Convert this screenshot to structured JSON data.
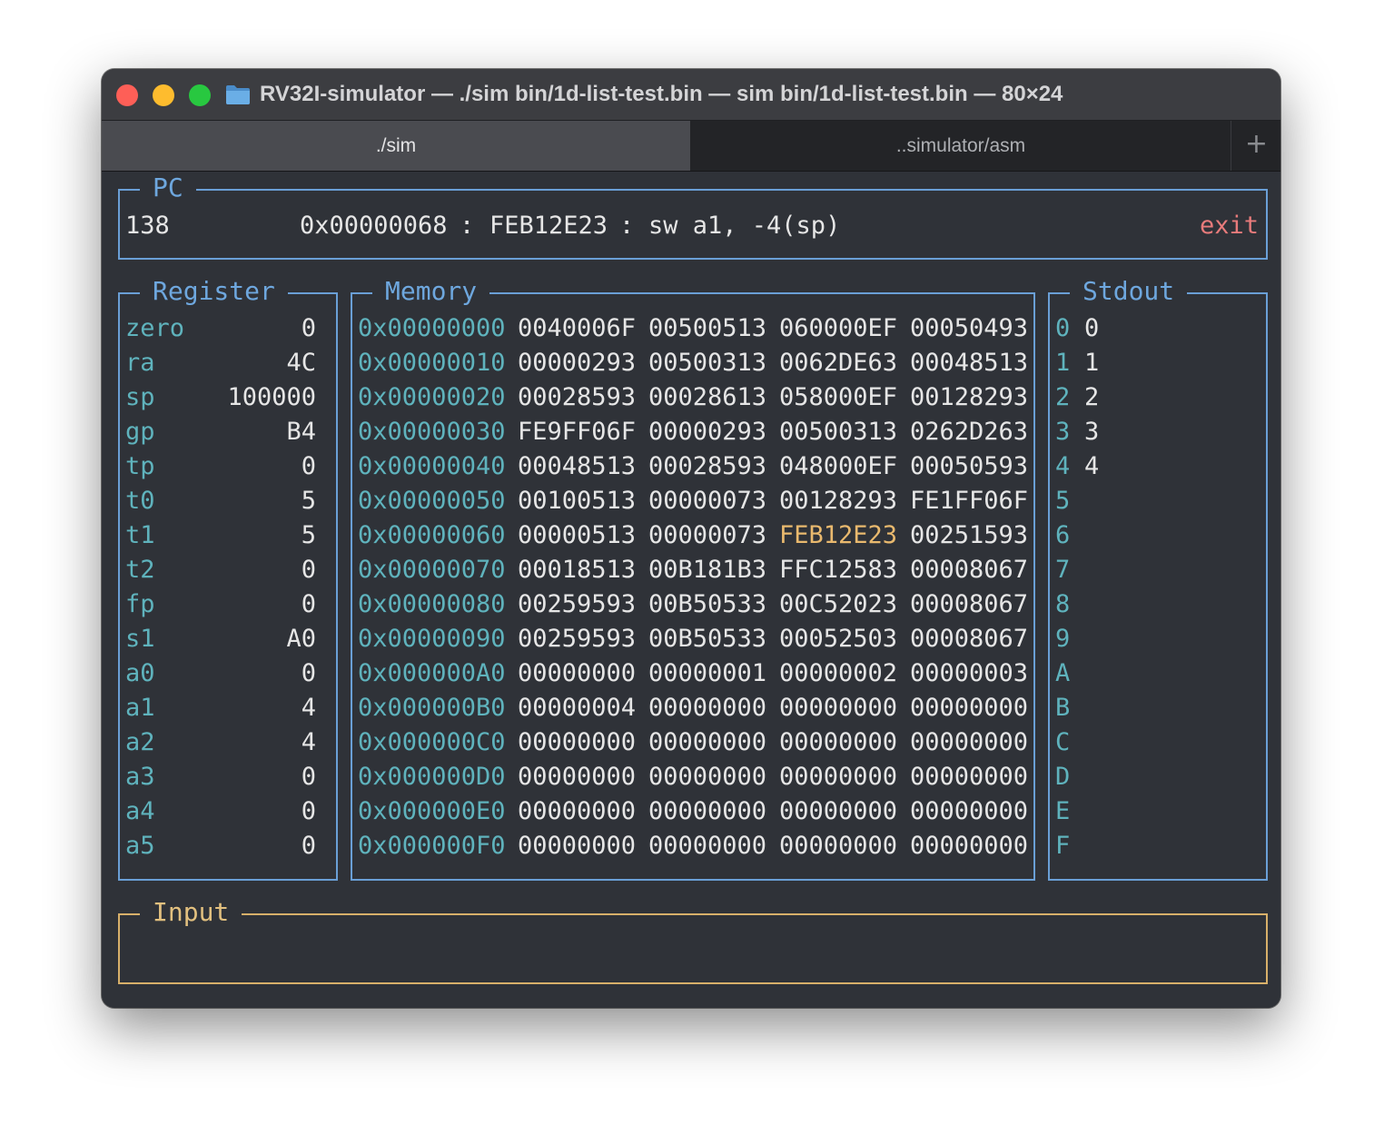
{
  "window": {
    "title": "RV32I-simulator — ./sim bin/1d-list-test.bin — sim bin/1d-list-test.bin — 80×24"
  },
  "tabs": [
    {
      "label": "./sim",
      "active": true
    },
    {
      "label": "..simulator/asm",
      "active": false
    }
  ],
  "new_tab_label": "+",
  "pc": {
    "title": "PC",
    "cycle": "138",
    "address": "0x00000068",
    "sep1": ":",
    "instr_hex": "FEB12E23",
    "sep2": ":",
    "asm": "sw a1, -4(sp)",
    "status": "exit"
  },
  "registers": {
    "title": "Register",
    "items": [
      {
        "name": "zero",
        "value": "0"
      },
      {
        "name": "ra",
        "value": "4C"
      },
      {
        "name": "sp",
        "value": "100000"
      },
      {
        "name": "gp",
        "value": "B4"
      },
      {
        "name": "tp",
        "value": "0"
      },
      {
        "name": "t0",
        "value": "5"
      },
      {
        "name": "t1",
        "value": "5"
      },
      {
        "name": "t2",
        "value": "0"
      },
      {
        "name": "fp",
        "value": "0"
      },
      {
        "name": "s1",
        "value": "A0"
      },
      {
        "name": "a0",
        "value": "0"
      },
      {
        "name": "a1",
        "value": "4"
      },
      {
        "name": "a2",
        "value": "4"
      },
      {
        "name": "a3",
        "value": "0"
      },
      {
        "name": "a4",
        "value": "0"
      },
      {
        "name": "a5",
        "value": "0"
      }
    ]
  },
  "memory": {
    "title": "Memory",
    "highlight_color": "#e9b96e",
    "rows": [
      {
        "addr": "0x00000000",
        "words": [
          "0040006F",
          "00500513",
          "060000EF",
          "00050493"
        ]
      },
      {
        "addr": "0x00000010",
        "words": [
          "00000293",
          "00500313",
          "0062DE63",
          "00048513"
        ]
      },
      {
        "addr": "0x00000020",
        "words": [
          "00028593",
          "00028613",
          "058000EF",
          "00128293"
        ]
      },
      {
        "addr": "0x00000030",
        "words": [
          "FE9FF06F",
          "00000293",
          "00500313",
          "0262D263"
        ]
      },
      {
        "addr": "0x00000040",
        "words": [
          "00048513",
          "00028593",
          "048000EF",
          "00050593"
        ]
      },
      {
        "addr": "0x00000050",
        "words": [
          "00100513",
          "00000073",
          "00128293",
          "FE1FF06F"
        ]
      },
      {
        "addr": "0x00000060",
        "words": [
          "00000513",
          "00000073",
          "FEB12E23",
          "00251593"
        ]
      },
      {
        "addr": "0x00000070",
        "words": [
          "00018513",
          "00B181B3",
          "FFC12583",
          "00008067"
        ]
      },
      {
        "addr": "0x00000080",
        "words": [
          "00259593",
          "00B50533",
          "00C52023",
          "00008067"
        ]
      },
      {
        "addr": "0x00000090",
        "words": [
          "00259593",
          "00B50533",
          "00052503",
          "00008067"
        ]
      },
      {
        "addr": "0x000000A0",
        "words": [
          "00000000",
          "00000001",
          "00000002",
          "00000003"
        ]
      },
      {
        "addr": "0x000000B0",
        "words": [
          "00000004",
          "00000000",
          "00000000",
          "00000000"
        ]
      },
      {
        "addr": "0x000000C0",
        "words": [
          "00000000",
          "00000000",
          "00000000",
          "00000000"
        ]
      },
      {
        "addr": "0x000000D0",
        "words": [
          "00000000",
          "00000000",
          "00000000",
          "00000000"
        ]
      },
      {
        "addr": "0x000000E0",
        "words": [
          "00000000",
          "00000000",
          "00000000",
          "00000000"
        ]
      },
      {
        "addr": "0x000000F0",
        "words": [
          "00000000",
          "00000000",
          "00000000",
          "00000000"
        ]
      }
    ]
  },
  "stdout": {
    "title": "Stdout",
    "lines": [
      {
        "index": "0",
        "text": "0"
      },
      {
        "index": "1",
        "text": "1"
      },
      {
        "index": "2",
        "text": "2"
      },
      {
        "index": "3",
        "text": "3"
      },
      {
        "index": "4",
        "text": "4"
      },
      {
        "index": "5",
        "text": ""
      },
      {
        "index": "6",
        "text": ""
      },
      {
        "index": "7",
        "text": ""
      },
      {
        "index": "8",
        "text": ""
      },
      {
        "index": "9",
        "text": ""
      },
      {
        "index": "A",
        "text": ""
      },
      {
        "index": "B",
        "text": ""
      },
      {
        "index": "C",
        "text": ""
      },
      {
        "index": "D",
        "text": ""
      },
      {
        "index": "E",
        "text": ""
      },
      {
        "index": "F",
        "text": ""
      }
    ]
  },
  "input": {
    "title": "Input",
    "value": ""
  }
}
